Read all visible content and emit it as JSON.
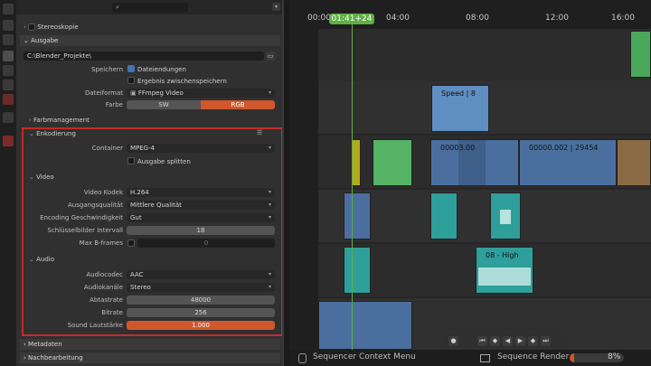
{
  "properties": {
    "top_row_label": "Stereoskopie",
    "output_section": "Ausgabe",
    "output_path": "C:\\Blender_Projekte\\",
    "speichern_label": "Speichern",
    "dateiendungen": "Dateiendungen",
    "ergebnis": "Ergebnis zwischenspeichern",
    "dateiformat_label": "Dateiformat",
    "dateiformat_value": "FFmpeg Video",
    "farbe_label": "Farbe",
    "farbe_sw": "SW",
    "farbe_rgb": "RGB",
    "farbmanagement": "Farbmanagement",
    "encoding_section": "Enkodierung",
    "container_label": "Container",
    "container_value": "MPEG-4",
    "ausgabe_splitten": "Ausgabe splitten",
    "video_section": "Video",
    "codec_label": "Video Kodek",
    "codec_value": "H.264",
    "quality_label": "Ausgangsqualität",
    "quality_value": "Mittlere Qualität",
    "speed_label": "Encoding Geschwindigkeit",
    "speed_value": "Gut",
    "keyframe_label": "Schlüsselbilder Intervall",
    "keyframe_value": "18",
    "bframes_label": "Max B-frames",
    "bframes_value": "0",
    "audio_section": "Audio",
    "audiocodec_label": "Audiocodec",
    "audiocodec_value": "AAC",
    "channels_label": "Audiokanäle",
    "channels_value": "Stereo",
    "samplerate_label": "Abtastrate",
    "samplerate_value": "48000",
    "bitrate_label": "Bitrate",
    "bitrate_value": "256",
    "volume_label": "Sound Lautstärke",
    "volume_value": "1.000",
    "metadaten": "Metadaten",
    "nachbearbeitung": "Nachbearbeitung"
  },
  "sequencer": {
    "ticks": [
      "00:00",
      "04:00",
      "08:00",
      "12:00",
      "16:00"
    ],
    "current_time": "01:41+24",
    "strip_speed": "Speed | 8",
    "strip_a": "00003.00",
    "strip_b": "00000.002 | 29454",
    "strip_audio": "08 - High"
  },
  "statusbar": {
    "context_menu": "Sequencer Context Menu",
    "render": "Sequence Render",
    "progress_text": "8%",
    "progress": 0.08
  },
  "colors": {
    "accent_orange": "#d0572c",
    "highlight_red": "#c42b2b",
    "playhead_green": "#5fb044"
  }
}
